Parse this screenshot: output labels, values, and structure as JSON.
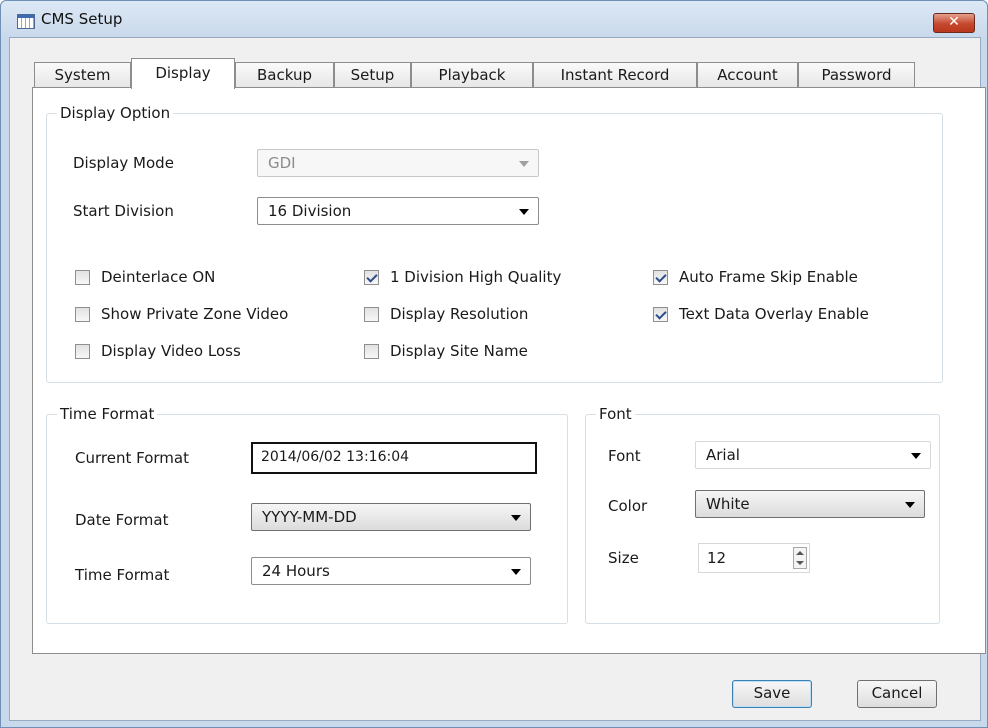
{
  "window": {
    "title": "CMS Setup",
    "close_glyph": "✕"
  },
  "tabs": [
    {
      "label": "System"
    },
    {
      "label": "Display",
      "active": true
    },
    {
      "label": "Backup"
    },
    {
      "label": "Setup"
    },
    {
      "label": "Playback"
    },
    {
      "label": "Instant Record"
    },
    {
      "label": "Account"
    },
    {
      "label": "Password"
    }
  ],
  "display_option": {
    "title": "Display Option",
    "display_mode": {
      "label": "Display Mode",
      "value": "GDI",
      "enabled": false
    },
    "start_division": {
      "label": "Start Division",
      "value": "16 Division"
    },
    "checkboxes": [
      {
        "label": "Deinterlace ON",
        "checked": false
      },
      {
        "label": "Show Private Zone Video",
        "checked": false
      },
      {
        "label": "Display Video Loss",
        "checked": false
      },
      {
        "label": "1 Division High Quality",
        "checked": true
      },
      {
        "label": "Display Resolution",
        "checked": false
      },
      {
        "label": "Display Site Name",
        "checked": false
      },
      {
        "label": "Auto Frame Skip Enable",
        "checked": true
      },
      {
        "label": "Text Data Overlay Enable",
        "checked": true
      }
    ]
  },
  "time_format": {
    "title": "Time Format",
    "current_format": {
      "label": "Current Format",
      "value": "2014/06/02 13:16:04"
    },
    "date_format": {
      "label": "Date Format",
      "value": "YYYY-MM-DD"
    },
    "time_format": {
      "label": "Time Format",
      "value": "24 Hours"
    }
  },
  "font": {
    "title": "Font",
    "font": {
      "label": "Font",
      "value": "Arial"
    },
    "color": {
      "label": "Color",
      "value": "White"
    },
    "size": {
      "label": "Size",
      "value": "12"
    }
  },
  "buttons": {
    "save": "Save",
    "cancel": "Cancel"
  },
  "colors": {
    "window_frame": "#c9d9ec",
    "close_button": "#c5482d",
    "check_mark": "#2d4d8e",
    "default_button_border": "#3c7fb1"
  }
}
